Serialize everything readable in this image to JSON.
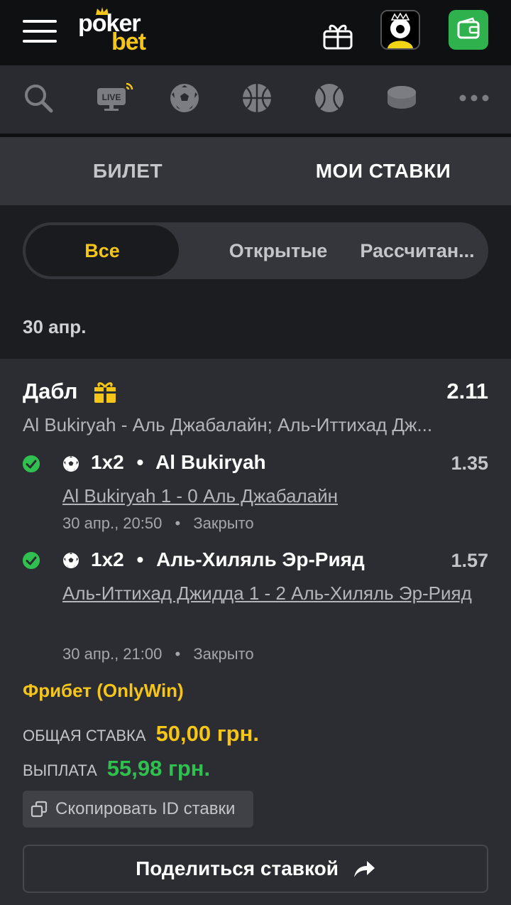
{
  "header": {
    "logo_top": "poker",
    "logo_bottom": "bet",
    "icons": [
      "menu-icon",
      "gift-icon",
      "avatar",
      "wallet-icon"
    ]
  },
  "sports_nav": [
    "search-icon",
    "live-icon",
    "football-icon",
    "basketball-icon",
    "tennis-icon",
    "hockey-icon",
    "more-icon"
  ],
  "live_label": "LIVE",
  "tabs": {
    "ticket": "БИЛЕТ",
    "my_bets": "МОИ СТАВКИ"
  },
  "filters": {
    "all": "Все",
    "open": "Открытые",
    "settled": "Рассчитан..."
  },
  "date_header": "30 апр.",
  "bet": {
    "type": "Дабл",
    "total_odds": "2.11",
    "events_summary": "Al Bukiryah - Аль Джабалайн; Аль-Иттихад Дж...",
    "selections": [
      {
        "market": "1x2",
        "separator": "•",
        "pick": "Al Bukiryah",
        "odds": "1.35",
        "result": "Al Bukiryah 1 - 0 Аль Джабалайн",
        "datetime": "30 апр., 20:50",
        "status": "Закрыто"
      },
      {
        "market": "1x2",
        "separator": "•",
        "pick": "Аль-Хиляль Эр-Рияд",
        "odds": "1.57",
        "result": "Аль-Иттихад Джидда 1 - 2 Аль-Хиляль Эр-Рияд",
        "datetime": "30 апр., 21:00",
        "status": "Закрыто"
      }
    ],
    "freebet_label": "Фрибет (OnlyWin)",
    "stake_label": "ОБЩАЯ СТАВКА",
    "stake_value": "50,00 грн.",
    "payout_label": "ВЫПЛАТА",
    "payout_value": "55,98 грн.",
    "copy_id_label": "Скопировать ID ставки",
    "share_label": "Поделиться ставкой"
  },
  "colors": {
    "accent_yellow": "#f5c518",
    "win_green": "#2fc04f",
    "wallet_green": "#2fb24d",
    "background": "#1c1d21",
    "card": "#2c2d32"
  }
}
